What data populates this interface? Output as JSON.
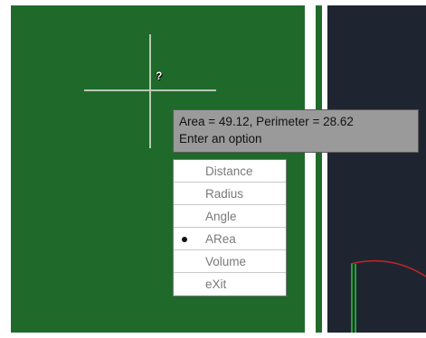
{
  "tooltip": {
    "line1": "Area = 49.12, Perimeter = 28.62",
    "line2": "Enter an option"
  },
  "cursor": {
    "label": "?"
  },
  "menu": {
    "selected": "ARea",
    "items": [
      {
        "label": "Distance",
        "selected": false
      },
      {
        "label": "Radius",
        "selected": false
      },
      {
        "label": "Angle",
        "selected": false
      },
      {
        "label": "ARea",
        "selected": true
      },
      {
        "label": "Volume",
        "selected": false
      },
      {
        "label": "eXit",
        "selected": false
      }
    ]
  },
  "colors": {
    "model_space_bg": "#1f6a2a",
    "dark_viewport_bg": "#1f2530",
    "arc": "#c0262a",
    "line": "#1ed03a"
  }
}
